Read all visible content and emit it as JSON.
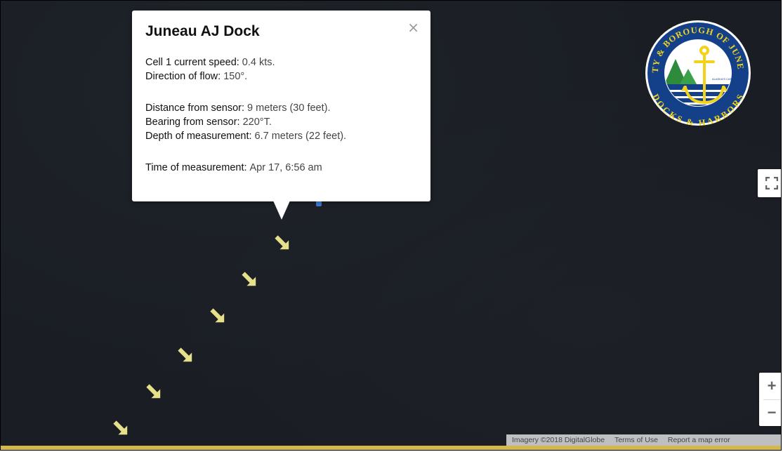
{
  "info_window": {
    "title": "Juneau AJ Dock",
    "close_glyph": "×",
    "lines": [
      {
        "label": "Cell 1 current speed:",
        "value": "0.4 kts."
      },
      {
        "label": "Direction of flow:",
        "value": "150°."
      },
      {
        "label": "Distance from sensor:",
        "value": "9 meters (30 feet)."
      },
      {
        "label": "Bearing from sensor:",
        "value": "220°T."
      },
      {
        "label": "Depth of measurement:",
        "value": "6.7 meters (22 feet)."
      },
      {
        "label": "Time of measurement:",
        "value": "Apr 17, 6:56 am"
      }
    ]
  },
  "current_arrows": {
    "count": 6,
    "direction_deg": 150,
    "color": "#e6e08a",
    "icon": "arrow-icon"
  },
  "logo": {
    "top_text": "CITY & BOROUGH OF JUNEAU",
    "bottom_text": "DOCKS & HARBORS",
    "inner_text": "ALASKA'S CAPITAL CITY",
    "ring_color": "#14408a",
    "accent_color": "#f2d21b"
  },
  "controls": {
    "fullscreen_icon": "fullscreen-icon",
    "zoom_in": "+",
    "zoom_out": "−"
  },
  "attribution": {
    "imagery": "Imagery ©2018 DigitalGlobe",
    "terms": "Terms of Use",
    "report": "Report a map error"
  },
  "colors": {
    "map_background": "#1a1e24",
    "bottom_strip": "#d4b84a"
  }
}
